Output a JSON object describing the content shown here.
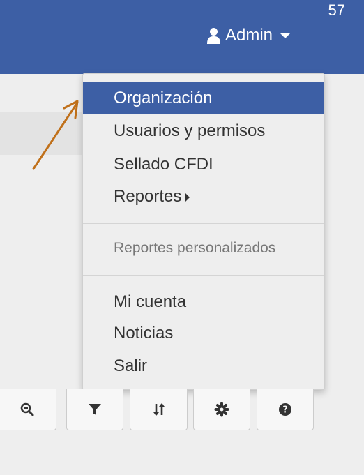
{
  "header": {
    "counter": "57",
    "user_label": "Admin",
    "user_icon": "user-icon",
    "caret_icon": "caret-down-icon"
  },
  "dropdown": {
    "items": [
      {
        "label": "Organización",
        "active": true
      },
      {
        "label": "Usuarios y permisos"
      },
      {
        "label": "Sellado CFDI"
      },
      {
        "label": "Reportes",
        "has_submenu": true
      }
    ],
    "section_header": "Reportes personalizados",
    "account_items": [
      {
        "label": "Mi cuenta"
      },
      {
        "label": "Noticias"
      },
      {
        "label": "Salir"
      }
    ]
  },
  "toolbar": {
    "buttons": [
      {
        "icon": "zoom-out-icon"
      },
      {
        "icon": "filter-icon"
      },
      {
        "icon": "sort-icon"
      },
      {
        "icon": "gear-icon"
      },
      {
        "icon": "help-icon"
      }
    ]
  },
  "colors": {
    "brand": "#3d5fa5",
    "background": "#eeeeee",
    "annotation": "#c0701a"
  }
}
